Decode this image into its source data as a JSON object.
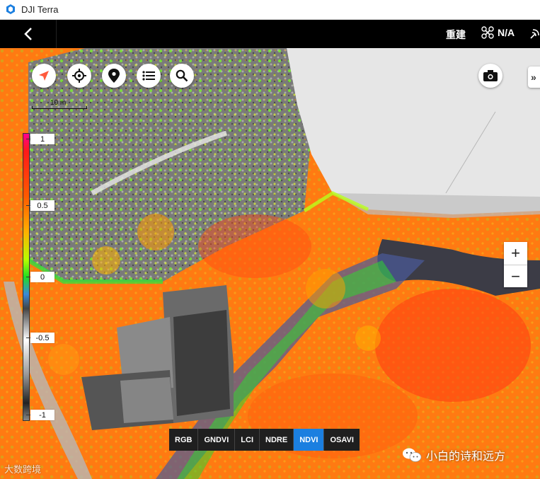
{
  "window": {
    "title": "DJI Terra"
  },
  "topbar": {
    "rebuild_label": "重建",
    "drone_status": "N/A"
  },
  "scale": {
    "label": "10 m"
  },
  "legend": {
    "ticks": [
      "1",
      "0.5",
      "0",
      "-0.5",
      "-1"
    ]
  },
  "index_bar": {
    "items": [
      "RGB",
      "GNDVI",
      "LCI",
      "NDRE",
      "NDVI",
      "OSAVI"
    ],
    "active": "NDVI"
  },
  "watermark": {
    "text": "小白的诗和远方",
    "logo_text": "大数跨境"
  },
  "colors": {
    "accent": "#1b7fe0",
    "topbar": "#000000",
    "index_bar": "#1f1f1f"
  }
}
